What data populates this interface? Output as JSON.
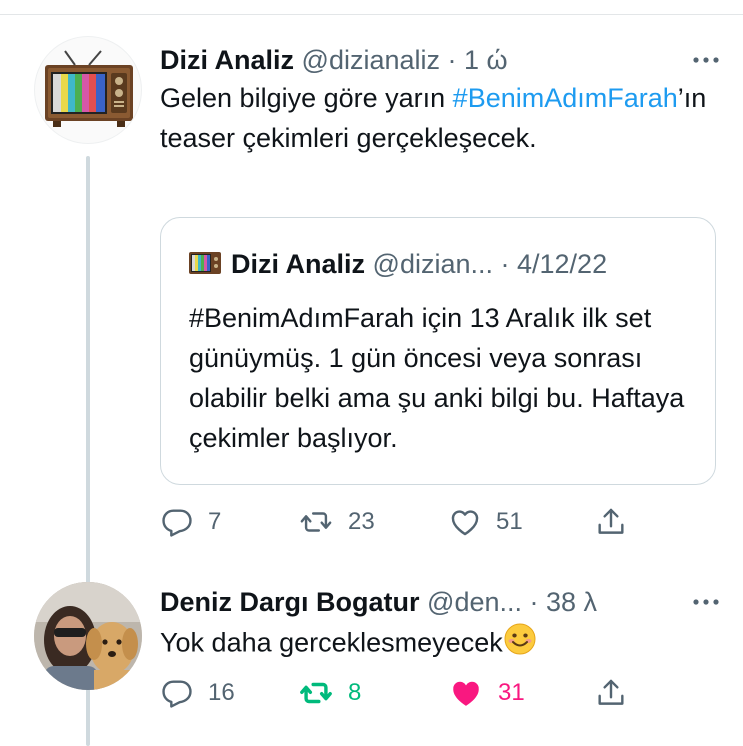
{
  "tweet1": {
    "name": "Dizi Analiz",
    "handle": "@dizianaliz",
    "time": "1 ώ",
    "text_before": "Gelen bilgiye göre yarın ",
    "hashtag": "#BenimAdımFarah",
    "text_after": "’ın teaser çekimleri gerçekleşecek.",
    "quote": {
      "name": "Dizi Analiz",
      "handle": "@dizian...",
      "date": "4/12/22",
      "text": "#BenimAdımFarah için 13 Aralık ilk set günüymüş. 1 gün öncesi veya sonrası olabilir belki ama şu anki bilgi bu. Haftaya çekimler başlıyor."
    },
    "stats": {
      "replies": "7",
      "retweets": "23",
      "likes": "51"
    }
  },
  "tweet2": {
    "name": "Deniz Dargı Bogatur",
    "handle": "@den...",
    "time": "38 λ",
    "text": "Yok daha gerceklesmeyecek",
    "emoji": "smiling-face",
    "stats": {
      "replies": "16",
      "retweets": "8",
      "likes": "31"
    }
  },
  "colors": {
    "accent": "#1d9bf0",
    "retweet_active": "#00ba7c",
    "like_active": "#f91880",
    "muted": "#536471"
  },
  "icons": [
    "reply-icon",
    "retweet-icon",
    "like-icon",
    "share-icon",
    "more-icon",
    "tv-icon"
  ]
}
